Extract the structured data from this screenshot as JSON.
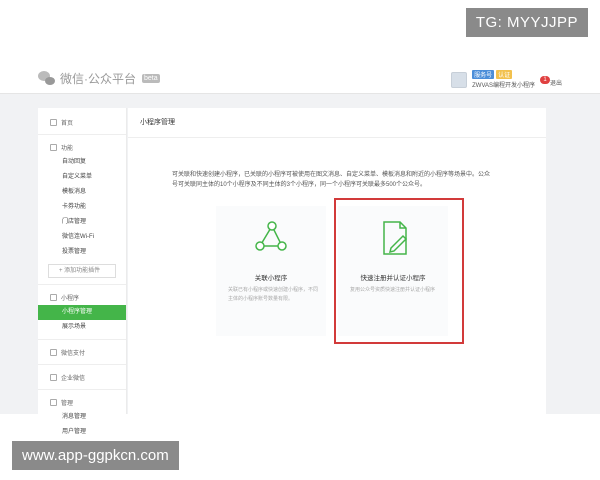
{
  "watermarks": {
    "top": "TG: MYYJJPP",
    "bottom": "www.app-ggpkcn.com"
  },
  "header": {
    "logo_text": "微信·公众平台",
    "logo_badge": "beta",
    "user_tag_1": "服务号",
    "user_tag_2": "认证",
    "user_name": "ZWVAS编程开发小程序",
    "notification_count": "1",
    "logout_label": "退出"
  },
  "sidebar": {
    "home": "首页",
    "feature_section": "功能",
    "feature_items": [
      "自动回复",
      "自定义菜单",
      "模板消息",
      "卡券功能",
      "门店管理",
      "微信连Wi-Fi",
      "投票管理"
    ],
    "add_plugin": "+ 添加功能插件",
    "miniprogram_section": "小程序",
    "miniprogram_items": [
      "小程序管理",
      "展示场景"
    ],
    "wechat_pay": "微信支付",
    "enterprise": "企业微信",
    "manage_section": "管理",
    "manage_items": [
      "消息管理",
      "用户管理"
    ]
  },
  "main": {
    "title": "小程序管理",
    "description": "可关联和快速创建小程序，已关联的小程序可被使用在图文消息、自定义菜单、模板消息和附近的小程序等场景中。公众号可关联同主体的10个小程序及不同主体的3个小程序，同一个小程序可关联最多500个公众号。",
    "card_link": {
      "title": "关联小程序",
      "desc": "关联已有小程序或快速创建小程序，不同主体的小程序账号数量有限。"
    },
    "card_register": {
      "title": "快速注册并认证小程序",
      "desc": "复用公众号资质快速注册并认证小程序"
    }
  },
  "colors": {
    "accent_green": "#44b549",
    "highlight_red": "#d23a3a"
  }
}
